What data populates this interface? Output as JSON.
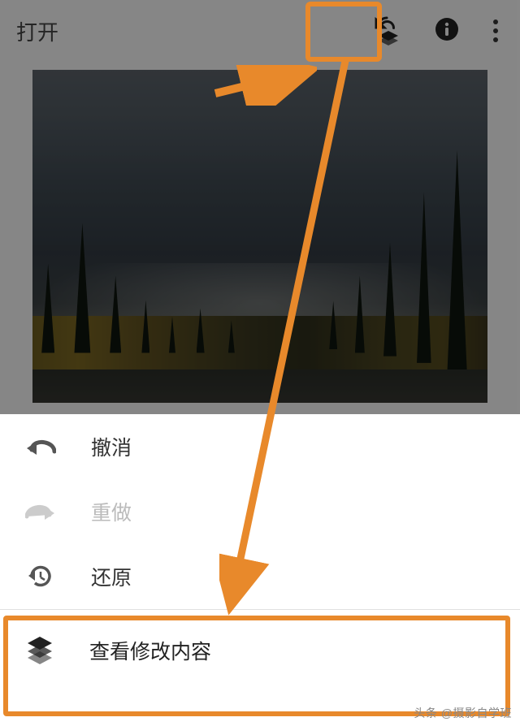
{
  "toolbar": {
    "open_label": "打开"
  },
  "menu": {
    "undo": "撤消",
    "redo": "重做",
    "revert": "还原",
    "view_edits": "查看修改内容"
  },
  "watermark": "头条 @摄影自学班",
  "annotations": {
    "highlight_color": "#e8892b"
  }
}
